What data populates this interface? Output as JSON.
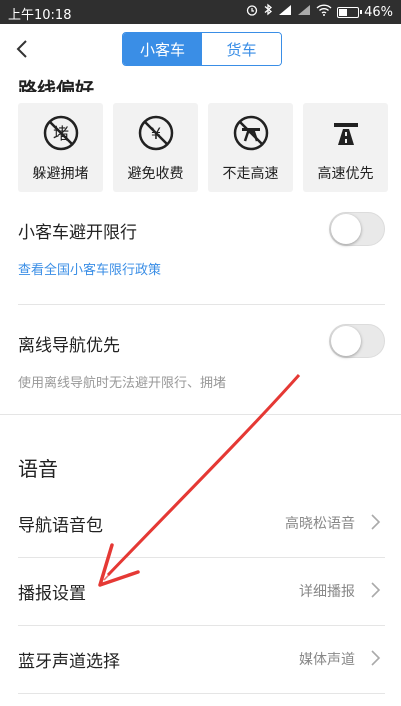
{
  "status_bar": {
    "time": "上午10:18",
    "battery": "46%",
    "battery_level": 0.46
  },
  "header": {
    "tabs": [
      {
        "label": "小客车",
        "active": true
      },
      {
        "label": "货车",
        "active": false
      }
    ]
  },
  "route_prefs": {
    "title": "路线偏好",
    "items": [
      {
        "label": "躲避拥堵",
        "icon": "avoid-congestion-icon"
      },
      {
        "label": "避免收费",
        "icon": "avoid-toll-icon"
      },
      {
        "label": "不走高速",
        "icon": "no-highway-icon"
      },
      {
        "label": "高速优先",
        "icon": "highway-first-icon"
      }
    ]
  },
  "restriction": {
    "title": "小客车避开限行",
    "link": "查看全国小客车限行政策",
    "enabled": false
  },
  "offline": {
    "title": "离线导航优先",
    "note": "使用离线导航时无法避开限行、拥堵",
    "enabled": false
  },
  "voice": {
    "title": "语音",
    "rows": [
      {
        "label": "导航语音包",
        "value": "高晓松语音"
      },
      {
        "label": "播报设置",
        "value": "详细播报"
      },
      {
        "label": "蓝牙声道选择",
        "value": "媒体声道"
      }
    ]
  },
  "colors": {
    "accent": "#3a8ee6",
    "annotation_arrow": "#e53935"
  }
}
